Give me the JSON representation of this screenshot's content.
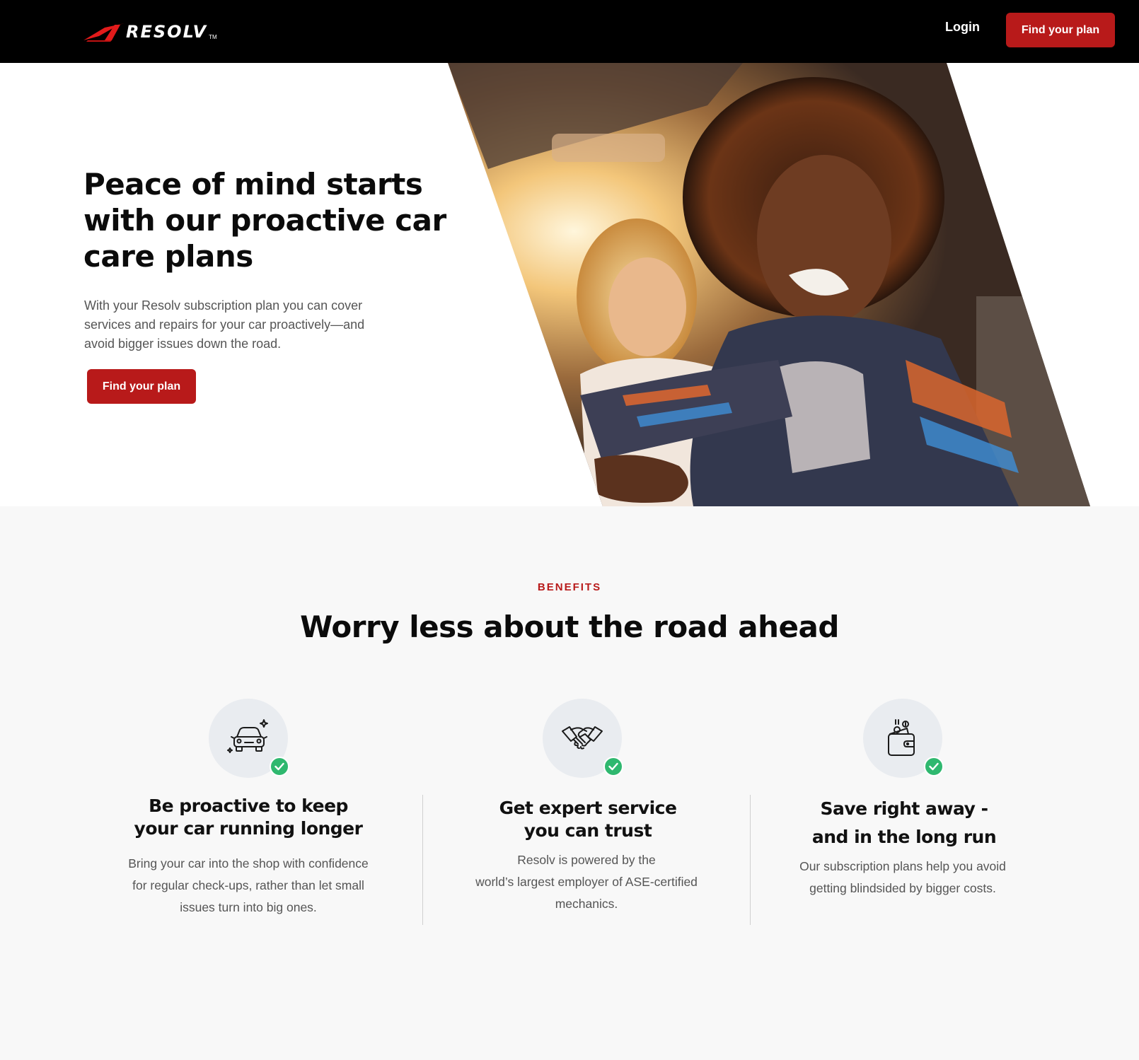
{
  "header": {
    "logo_text": "RESOLV",
    "logo_tm": "TM",
    "login_label": "Login",
    "cta_label": "Find your plan"
  },
  "hero": {
    "title": "Peace of mind starts with our proactive car care plans",
    "subtitle": "With your Resolv subscription plan you can cover services and repairs for your car proactively—and avoid bigger issues down the road.",
    "cta_label": "Find your plan"
  },
  "benefits": {
    "eyebrow": "BENEFITS",
    "title": "Worry less about the road ahead",
    "items": [
      {
        "icon": "car-sparkle-icon",
        "title_line1": "Be proactive to keep",
        "title_line2": "your car running longer",
        "text_line1": "Bring your car into the shop with confidence",
        "text_line2": "for regular check-ups, rather than let small",
        "text_line3": "issues turn into big ones."
      },
      {
        "icon": "handshake-icon",
        "title_line1": "Get expert service",
        "title_line2": "you can trust",
        "text_line1": "Resolv is powered by the",
        "text_line2": "world’s largest employer of ASE-certified",
        "text_line3": "mechanics."
      },
      {
        "icon": "wallet-coins-icon",
        "title_line1": "Save right away -",
        "title_line2": "and in the long run",
        "text_line1": "Our subscription plans help you avoid",
        "text_line2": "getting blindsided by bigger costs."
      }
    ]
  },
  "colors": {
    "brand_red": "#b81a1a",
    "header_bg": "#000000",
    "check_green": "#2fb86f",
    "section_bg": "#f8f8f8"
  }
}
